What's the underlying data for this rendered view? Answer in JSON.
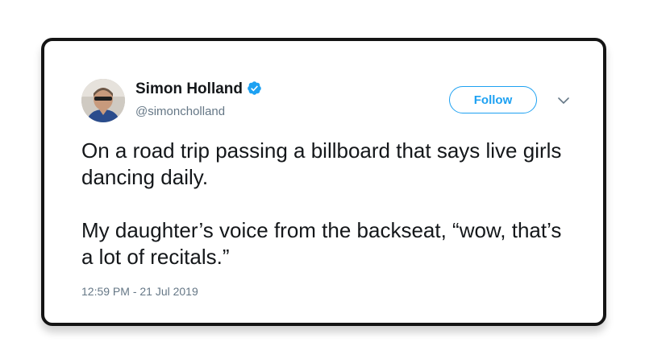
{
  "author": {
    "display_name": "Simon Holland",
    "handle": "@simoncholland",
    "verified": true,
    "verified_icon": "verified-badge-icon",
    "avatar_icon": "avatar-photo"
  },
  "actions": {
    "follow_label": "Follow",
    "more_icon": "chevron-down-icon"
  },
  "tweet": {
    "lines": [
      "On a road trip passing a billboard that says live girls dancing daily.",
      "My daughter’s voice from the backseat, “wow, that’s a lot of recitals.”"
    ],
    "timestamp": "12:59 PM - 21 Jul 2019"
  },
  "colors": {
    "accent": "#1da1f2",
    "text": "#14171a",
    "muted": "#657786",
    "card_border": "#141414"
  }
}
